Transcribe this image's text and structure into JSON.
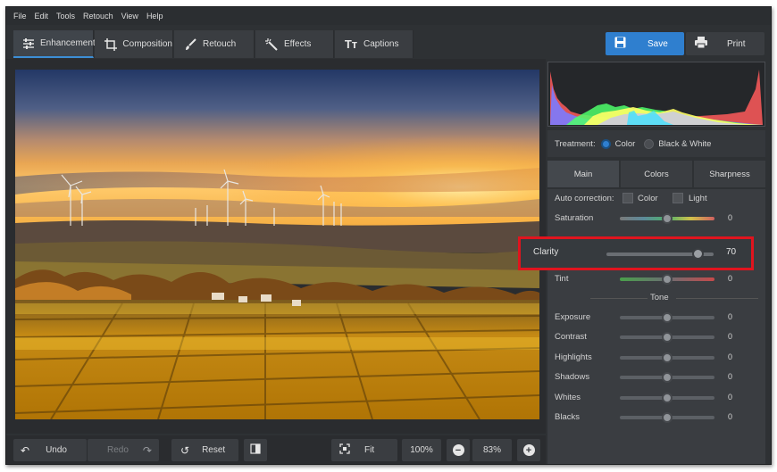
{
  "menu": [
    "File",
    "Edit",
    "Tools",
    "Retouch",
    "View",
    "Help"
  ],
  "tabs": [
    {
      "label": "Enhancement",
      "icon": "sliders-icon"
    },
    {
      "label": "Composition",
      "icon": "crop-icon"
    },
    {
      "label": "Retouch",
      "icon": "brush-icon"
    },
    {
      "label": "Effects",
      "icon": "magic-wand-icon"
    },
    {
      "label": "Captions",
      "icon": "text-icon"
    }
  ],
  "actions": {
    "save": "Save",
    "print": "Print"
  },
  "bottom": {
    "undo": "Undo",
    "redo": "Redo",
    "reset": "Reset",
    "fit": "Fit",
    "zoom_100": "100%",
    "zoom_current": "83%"
  },
  "treatment": {
    "label": "Treatment:",
    "color": "Color",
    "bw": "Black & White",
    "selected": "Color"
  },
  "adjust_tabs": [
    "Main",
    "Colors",
    "Sharpness"
  ],
  "auto_correction": {
    "label": "Auto correction:",
    "color": "Color",
    "light": "Light"
  },
  "sliders": {
    "saturation": {
      "label": "Saturation",
      "value": "0",
      "level": 0.5
    },
    "clarity": {
      "label": "Clarity",
      "value": "70",
      "level": 0.85
    },
    "tint": {
      "label": "Tint",
      "value": "0",
      "level": 0.5
    }
  },
  "tone": {
    "title": "Tone",
    "exposure": {
      "label": "Exposure",
      "value": "0",
      "level": 0.5
    },
    "contrast": {
      "label": "Contrast",
      "value": "0",
      "level": 0.5
    },
    "highlights": {
      "label": "Highlights",
      "value": "0",
      "level": 0.5
    },
    "shadows": {
      "label": "Shadows",
      "value": "0",
      "level": 0.5
    },
    "whites": {
      "label": "Whites",
      "value": "0",
      "level": 0.5
    },
    "blacks": {
      "label": "Blacks",
      "value": "0",
      "level": 0.5
    }
  },
  "colors": {
    "accent": "#2f7fcf",
    "highlight_box": "#e0141e"
  }
}
